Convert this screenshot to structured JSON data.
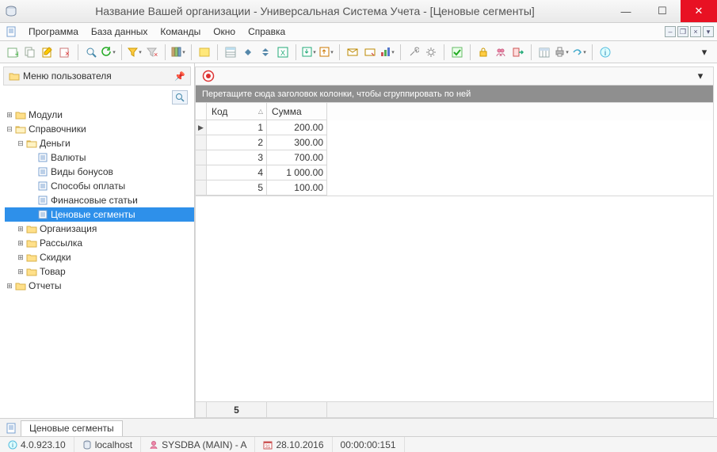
{
  "window": {
    "title": "Название Вашей организации - Универсальная Система Учета - [Ценовые сегменты]"
  },
  "menu": {
    "items": [
      "Программа",
      "База данных",
      "Команды",
      "Окно",
      "Справка"
    ]
  },
  "left_panel": {
    "title": "Меню пользователя"
  },
  "tree": {
    "modules": "Модули",
    "directories": "Справочники",
    "money": "Деньги",
    "currencies": "Валюты",
    "bonus_types": "Виды бонусов",
    "payment_methods": "Способы оплаты",
    "financial_items": "Финансовые статьи",
    "price_segments": "Ценовые сегменты",
    "organization": "Организация",
    "mailing": "Рассылка",
    "discounts": "Скидки",
    "goods": "Товар",
    "reports": "Отчеты"
  },
  "grid": {
    "group_hint": "Перетащите сюда заголовок колонки, чтобы сгруппировать по ней",
    "columns": {
      "code": "Код",
      "sum": "Сумма"
    },
    "rows": [
      {
        "code": "1",
        "sum": "200.00"
      },
      {
        "code": "2",
        "sum": "300.00"
      },
      {
        "code": "3",
        "sum": "700.00"
      },
      {
        "code": "4",
        "sum": "1 000.00"
      },
      {
        "code": "5",
        "sum": "100.00"
      }
    ],
    "footer_count": "5"
  },
  "tabs": {
    "active": "Ценовые сегменты"
  },
  "status": {
    "version": "4.0.923.10",
    "host": "localhost",
    "user": "SYSDBA (MAIN) - A",
    "date": "28.10.2016",
    "elapsed": "00:00:00:151"
  }
}
